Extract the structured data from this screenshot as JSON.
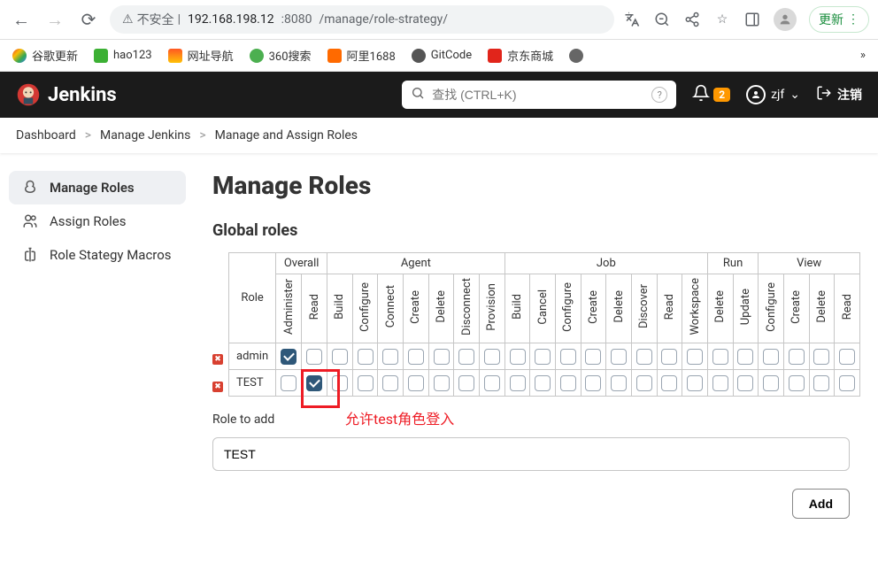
{
  "browser": {
    "url_insecure_label": "不安全",
    "url_host": "192.168.198.12",
    "url_port": ":8080",
    "url_path": "/manage/role-strategy/",
    "update_label": "更新"
  },
  "bookmarks": [
    {
      "label": "谷歌更新",
      "icon": "bm-chrome"
    },
    {
      "label": "hao123",
      "icon": "bm-hao"
    },
    {
      "label": "网址导航",
      "icon": "bm-2345"
    },
    {
      "label": "360搜索",
      "icon": "bm-360"
    },
    {
      "label": "阿里1688",
      "icon": "bm-1688"
    },
    {
      "label": "GitCode",
      "icon": "bm-git"
    },
    {
      "label": "京东商城",
      "icon": "bm-jd"
    },
    {
      "label": "",
      "icon": "bm-globe"
    }
  ],
  "header": {
    "brand": "Jenkins",
    "search_placeholder": "查找 (CTRL+K)",
    "notif_count": "2",
    "username": "zjf",
    "logout_label": "注销"
  },
  "breadcrumbs": [
    "Dashboard",
    "Manage Jenkins",
    "Manage and Assign Roles"
  ],
  "sidebar": [
    {
      "label": "Manage Roles",
      "active": true
    },
    {
      "label": "Assign Roles",
      "active": false
    },
    {
      "label": "Role Stategy Macros",
      "active": false
    }
  ],
  "page": {
    "title": "Manage Roles",
    "section": "Global roles",
    "role_header": "Role",
    "groups": [
      "Overall",
      "Agent",
      "Job",
      "Run",
      "View"
    ],
    "perms": {
      "Overall": [
        "Administer",
        "Read"
      ],
      "Agent": [
        "Build",
        "Configure",
        "Connect",
        "Create",
        "Delete",
        "Disconnect",
        "Provision"
      ],
      "Job": [
        "Build",
        "Cancel",
        "Configure",
        "Create",
        "Delete",
        "Discover",
        "Read",
        "Workspace"
      ],
      "Run": [
        "Delete",
        "Update"
      ],
      "View": [
        "Configure",
        "Create",
        "Delete",
        "Read"
      ]
    },
    "rows": [
      {
        "name": "admin",
        "checked": [
          "Overall.Administer"
        ]
      },
      {
        "name": "TEST",
        "checked": [
          "Overall.Read"
        ]
      }
    ],
    "annotation": "允许test角色登入",
    "role_to_add_label": "Role to add",
    "role_to_add_value": "TEST",
    "add_button": "Add"
  }
}
